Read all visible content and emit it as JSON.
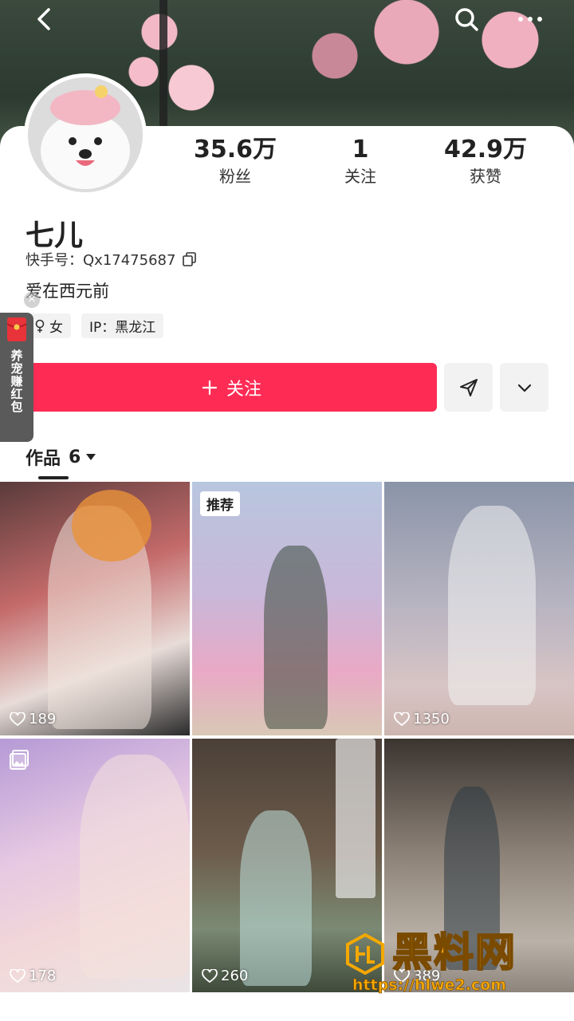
{
  "profile": {
    "name": "七儿",
    "uid_label": "快手号：Qx17475687",
    "bio": "爱在西元前",
    "gender_tag": "女",
    "ip_tag": "IP：黑龙江"
  },
  "stats": [
    {
      "value": "35.6万",
      "label": "粉丝"
    },
    {
      "value": "1",
      "label": "关注"
    },
    {
      "value": "42.9万",
      "label": "获赞"
    }
  ],
  "actions": {
    "follow_label": "关注"
  },
  "side_promo": {
    "text": "养宠赚红包"
  },
  "works_tab": {
    "label": "作品",
    "count": "6"
  },
  "posts": [
    {
      "likes": "189"
    },
    {
      "likes": "",
      "badge": "推荐"
    },
    {
      "likes": "1350"
    },
    {
      "likes": "178"
    },
    {
      "likes": "260"
    },
    {
      "likes": "389"
    }
  ],
  "watermark": {
    "title": "黑料网",
    "url": "https://hlwe2.com"
  },
  "icons": {
    "back": "back-icon",
    "search": "search-icon",
    "more": "more-icon",
    "copy": "copy-icon",
    "share": "send-icon",
    "dropdown": "chevron-down-icon",
    "heart": "heart-icon",
    "gallery": "gallery-icon"
  },
  "colors": {
    "accent": "#fe2c55",
    "watermark": "#f5a800"
  }
}
